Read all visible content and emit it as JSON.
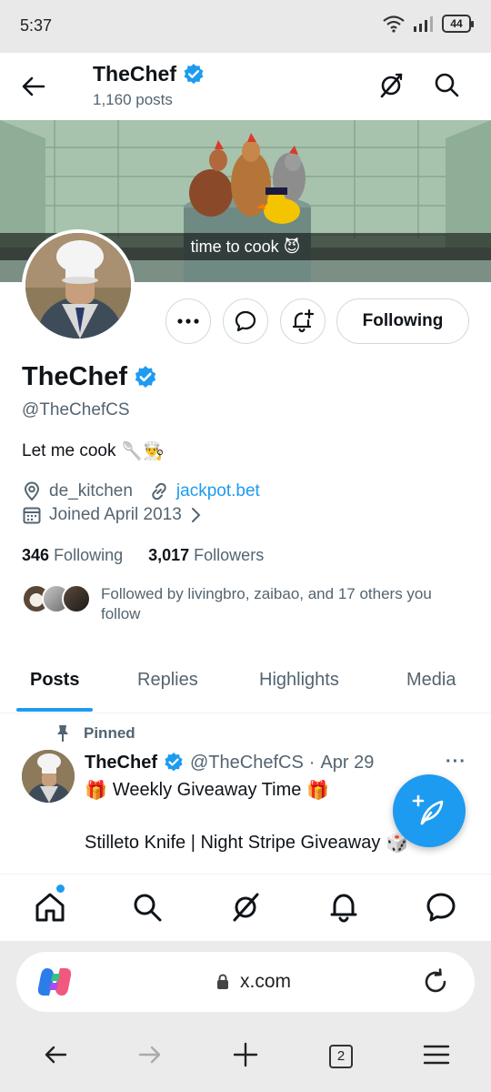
{
  "status_bar": {
    "time": "5:37",
    "battery": "44",
    "icons": [
      "wifi-icon",
      "signal-icon",
      "battery-icon"
    ]
  },
  "header": {
    "title": "TheChef",
    "posts_count": "1,160 posts",
    "icons": [
      "back-arrow-icon",
      "grok-icon",
      "search-icon"
    ]
  },
  "banner": {
    "caption": "time to cook 😈"
  },
  "profile": {
    "name": "TheChef",
    "handle": "@TheChefCS",
    "bio": "Let me cook",
    "bio_emoji": "🥄👨‍🍳",
    "location": "de_kitchen",
    "website": "jackpot.bet",
    "joined": "Joined April 2013",
    "following_count": "346",
    "following_label": "Following",
    "followers_count": "3,017",
    "followers_label": "Followers",
    "followed_by": "Followed by livingbro, zaibao, and 17 others you follow"
  },
  "actions": {
    "more": "more-icon",
    "message": "message-icon",
    "notify": "notification-add-icon",
    "follow_label": "Following"
  },
  "tabs": [
    {
      "label": "Posts",
      "active": true
    },
    {
      "label": "Replies",
      "active": false
    },
    {
      "label": "Highlights",
      "active": false
    },
    {
      "label": "Media",
      "active": false
    }
  ],
  "post": {
    "pinned_label": "Pinned",
    "author": "TheChef",
    "handle": "@TheChefCS",
    "separator": "·",
    "date": "Apr 29",
    "line1_prefix": "🎁",
    "line1": "Weekly Giveaway Time",
    "line1_suffix": "🎁",
    "line2": "Stilleto Knife | Night Stripe Giveaway",
    "line2_suffix": "🎲"
  },
  "bottom_nav": [
    "home-icon",
    "search-icon",
    "grok-icon",
    "notifications-icon",
    "messages-icon"
  ],
  "browser": {
    "url": "x.com",
    "tab_count": "2"
  },
  "colors": {
    "accent": "#1d9bf0",
    "text": "#0f1419",
    "secondary": "#536471",
    "border": "#cfd9de"
  }
}
